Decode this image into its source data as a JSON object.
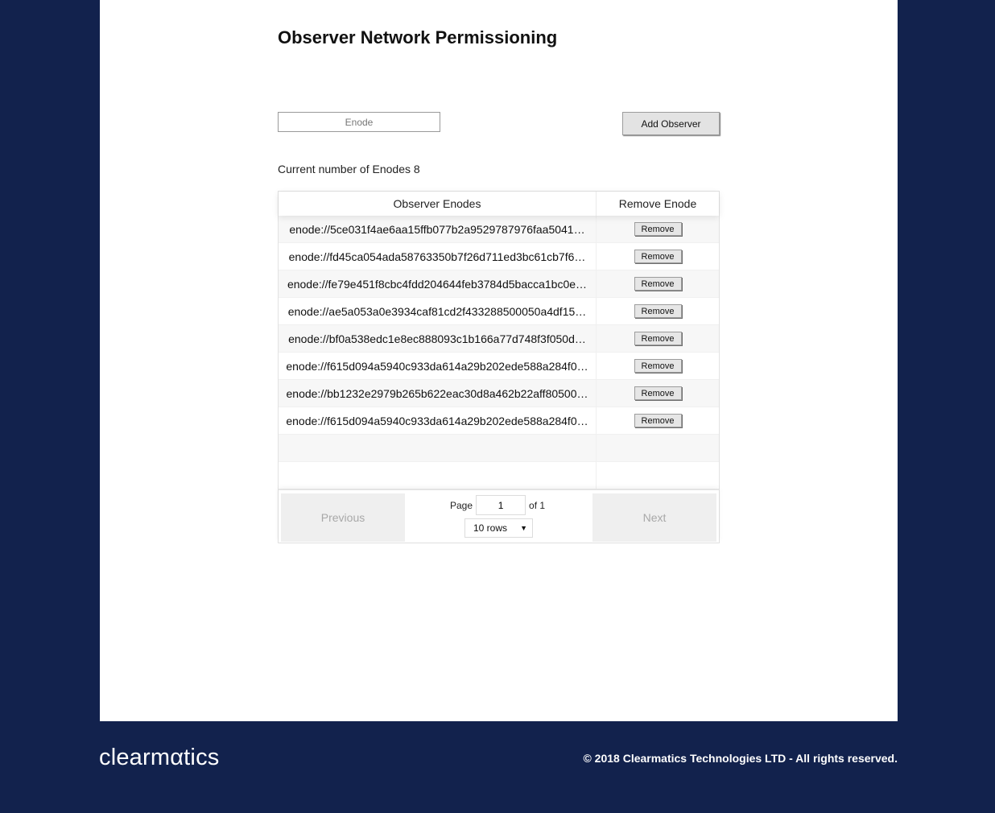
{
  "page": {
    "title": "Observer Network Permissioning"
  },
  "form": {
    "enode_placeholder": "Enode",
    "enode_value": "",
    "add_label": "Add Observer"
  },
  "count": {
    "label": "Current number of Enodes 8"
  },
  "table": {
    "headers": [
      "Observer Enodes",
      "Remove Enode"
    ],
    "remove_label": "Remove",
    "rows": [
      "enode://5ce031f4ae6aa15ffb077b2a9529787976faa5041…",
      "enode://fd45ca054ada58763350b7f26d711ed3bc61cb7f6…",
      "enode://fe79e451f8cbc4fdd204644feb3784d5bacca1bc0e…",
      "enode://ae5a053a0e3934caf81cd2f433288500050a4df15…",
      "enode://bf0a538edc1e8ec888093c1b166a77d748f3f050d…",
      "enode://f615d094a5940c933da614a29b202ede588a284f0…",
      "enode://bb1232e2979b265b622eac30d8a462b22aff80500…",
      "enode://f615d094a5940c933da614a29b202ede588a284f0…"
    ]
  },
  "pagination": {
    "previous": "Previous",
    "next": "Next",
    "page_label": "Page",
    "page_value": "1",
    "of_label": "of 1",
    "rows_option": "10 rows"
  },
  "footer": {
    "logo": "clearmαtics",
    "copyright": "© 2018 Clearmatics Technologies LTD - All rights reserved."
  }
}
